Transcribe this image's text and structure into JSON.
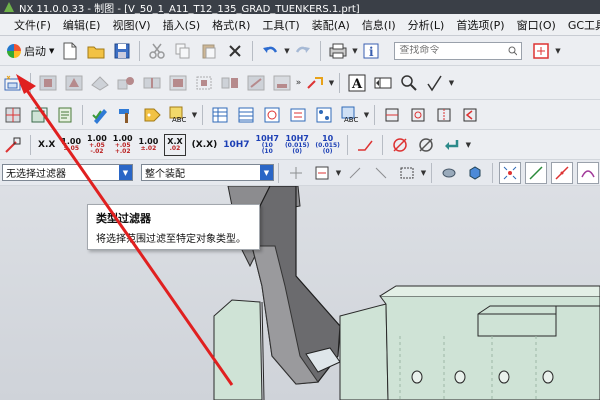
{
  "window": {
    "title": "NX 11.0.0.33 - 制图 - [V_50_1_A11_T12_135_GRAD_TUENKERS.1.prt]"
  },
  "menu": {
    "items": [
      "文件(F)",
      "编辑(E)",
      "视图(V)",
      "插入(S)",
      "格式(R)",
      "工具(T)",
      "装配(A)",
      "信息(I)",
      "分析(L)",
      "首选项(P)",
      "窗口(O)",
      "GC工具箱",
      "帮"
    ]
  },
  "toolbar1": {
    "start_label": "启动",
    "search_placeholder": "查找命令"
  },
  "toolbar4": {
    "tolerances": [
      {
        "main": "X.X",
        "upper": "",
        "lower": ""
      },
      {
        "main": "1.00",
        "upper": "±.05",
        "lower": ""
      },
      {
        "main": "1.00",
        "upper": "+.05",
        "lower": "-.02"
      },
      {
        "main": "1.00",
        "upper": "+.05",
        "lower": "+.02"
      },
      {
        "main": "1.00",
        "upper": "±.02",
        "lower": ""
      },
      {
        "main": "X.X",
        "upper": ".02",
        "lower": ""
      },
      {
        "main": "(X.X)",
        "upper": "",
        "lower": ""
      },
      {
        "main": "10H7",
        "upper": "",
        "lower": ""
      },
      {
        "main": "10H7",
        "upper": "(10",
        "lower": "(10"
      },
      {
        "main": "10H7",
        "upper": "(0.015)",
        "lower": "(0)"
      },
      {
        "main": "10",
        "upper": "(0.015)",
        "lower": "(0)"
      }
    ]
  },
  "selection_bar": {
    "type_filter_value": "无选择过滤器",
    "scope_value": "整个装配"
  },
  "tooltip": {
    "title": "类型过滤器",
    "body": "将选择范围过滤至特定对象类型。"
  },
  "colors": {
    "titlebar": "#3a3f47",
    "part_fill": "#cfe3d6",
    "part_edge": "#2a2a2a",
    "arm_fill": "#6b6b6e",
    "annotation_arrow": "#e02020",
    "combo_arrow": "#2a66c6"
  },
  "icons": [
    "nx-logo",
    "new-file-icon",
    "open-folder-icon",
    "save-icon",
    "cut-icon",
    "copy-icon",
    "paste-icon",
    "delete-icon",
    "undo-icon",
    "redo-icon",
    "type-filter-icon",
    "text-annotation-icon",
    "tolerance-icon"
  ]
}
